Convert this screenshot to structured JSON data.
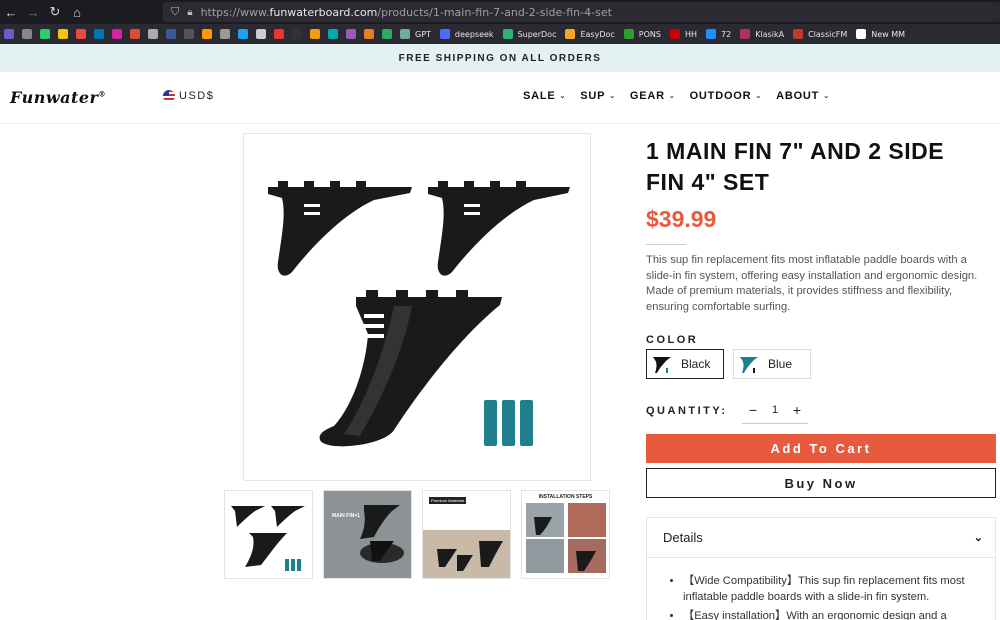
{
  "browser": {
    "url_prefix": "https://www.",
    "url_domain": "funwaterboard.com",
    "url_path": "/products/1-main-fin-7-and-2-side-fin-4-set",
    "bookmarks": [
      {
        "label": "GPT",
        "color": "#74aa9c"
      },
      {
        "label": "deepseek",
        "color": "#4d6bfe"
      },
      {
        "label": "SuperDoc",
        "color": "#2bb673"
      },
      {
        "label": "EasyDoc",
        "color": "#f5a623"
      },
      {
        "label": "PONS",
        "color": "#2ca02c"
      },
      {
        "label": "HH",
        "color": "#cc0000"
      },
      {
        "label": "72",
        "color": "#1e90ff"
      },
      {
        "label": "KlasikA",
        "color": "#b03060"
      },
      {
        "label": "ClassicFM",
        "color": "#c0392b"
      },
      {
        "label": "New MM",
        "color": "#ffffff"
      }
    ],
    "bookmark_only_icons": [
      "#6a5acd",
      "#888",
      "#2ecc71",
      "#f1c40f",
      "#e74c3c",
      "#0077b5",
      "#d6249f",
      "#dd4b39",
      "#aaa",
      "#3b5998",
      "#555",
      "#ff9900",
      "#999",
      "#1da1f2",
      "#ccc",
      "#e33",
      "#333",
      "#f39c12",
      "#0aa",
      "#9b59b6",
      "#e67e22",
      "#27ae60"
    ]
  },
  "site": {
    "announcement": "FREE SHIPPING ON ALL ORDERS",
    "logo": "Funwater",
    "logo_mark": "®",
    "currency": "USD$",
    "menu": [
      {
        "label": "SALE"
      },
      {
        "label": "SUP"
      },
      {
        "label": "GEAR"
      },
      {
        "label": "OUTDOOR"
      },
      {
        "label": "ABOUT"
      }
    ]
  },
  "product": {
    "title": "1 MAIN FIN 7\" AND 2 SIDE FIN 4\" SET",
    "price": "$39.99",
    "description": "This sup fin replacement fits most inflatable paddle boards with a slide-in fin system, offering easy installation and ergonomic design. Made of premium materials, it provides stiffness and flexibility, ensuring comfortable surfing.",
    "color_label": "COLOR",
    "colors": [
      {
        "label": "Black",
        "selected": true
      },
      {
        "label": "Blue",
        "selected": false
      }
    ],
    "quantity_label": "QUANTITY:",
    "quantity": "1",
    "minus": "−",
    "plus": "+",
    "add_to_cart": "Add To Cart",
    "buy_now": "Buy Now",
    "details_title": "Details",
    "details": [
      "【Wide Compatibility】This sup fin replacement fits most inflatable paddle boards with a slide-in fin system.",
      "【Easy installation】With an ergonomic design and a"
    ],
    "thumbnails": [
      {
        "caption": ""
      },
      {
        "caption": "MAIN FIN×1"
      },
      {
        "caption": "Premium Materials"
      },
      {
        "caption": "INSTALLATION STEPS"
      }
    ]
  }
}
